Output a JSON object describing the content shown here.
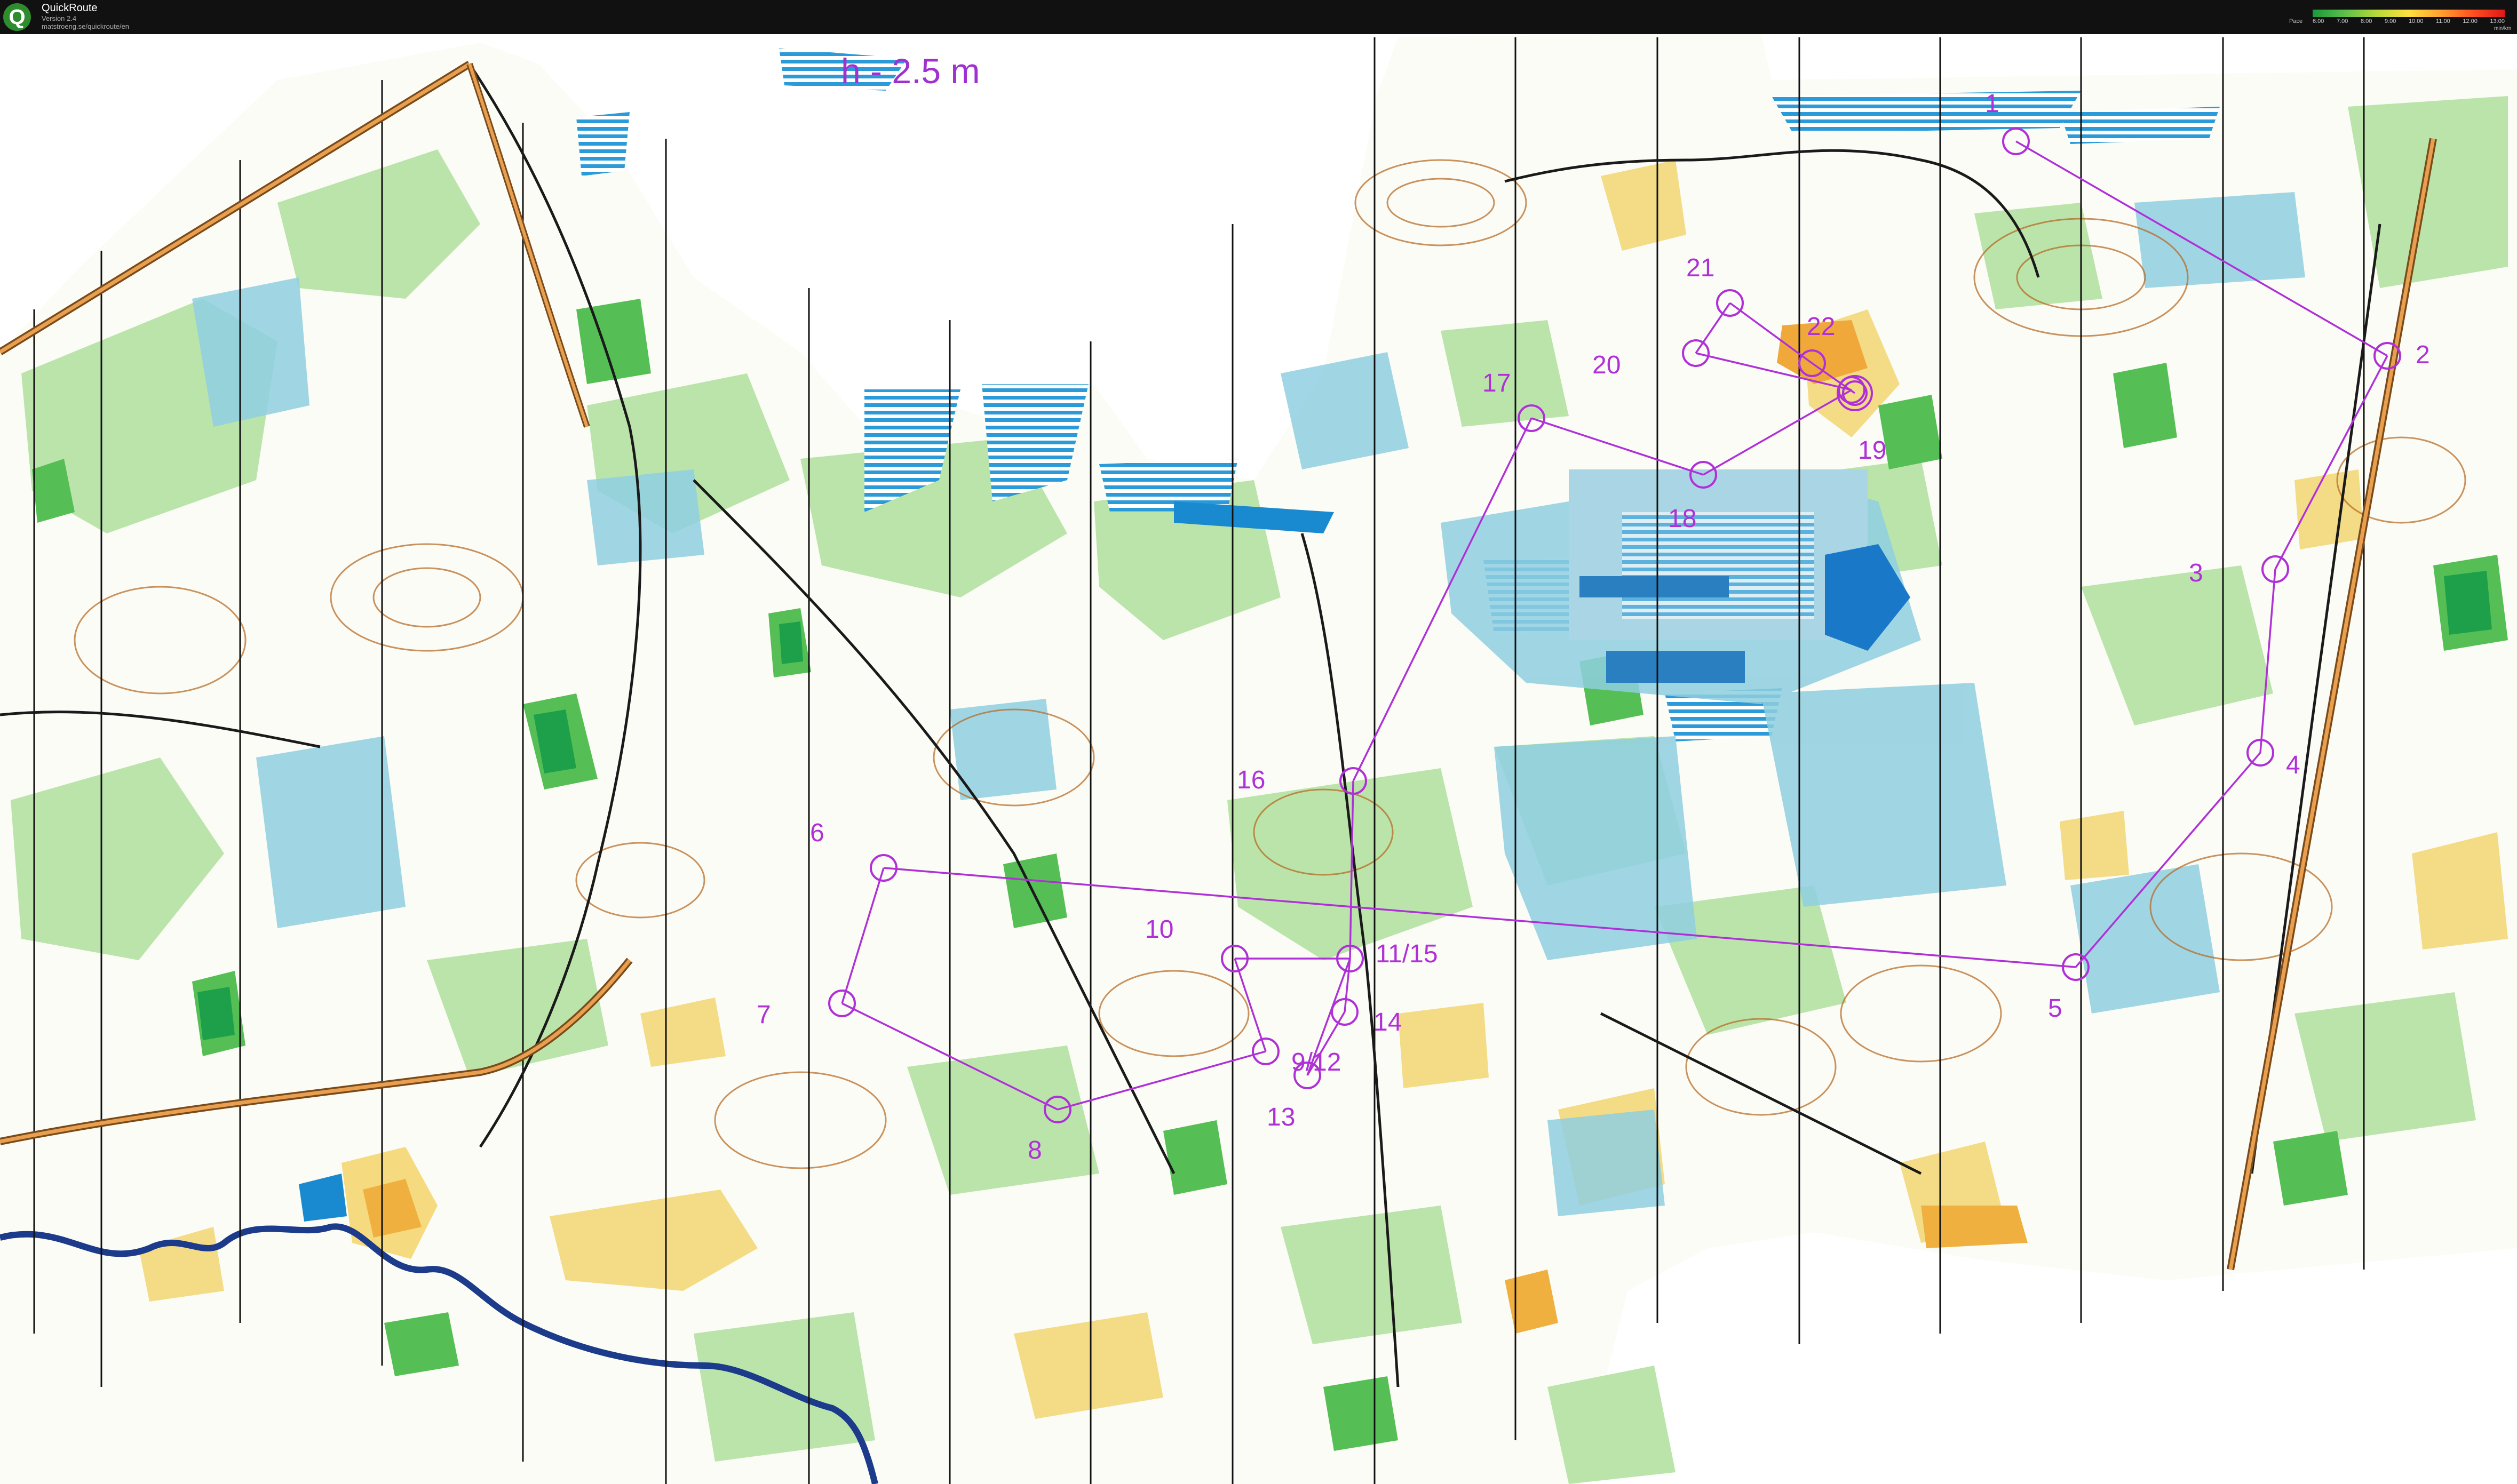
{
  "app": {
    "title": "QuickRoute",
    "version": "Version 2.4",
    "url": "matstroeng.se/quickroute/en"
  },
  "pace_legend": {
    "label": "Pace",
    "ticks": [
      "6:00",
      "7:00",
      "8:00",
      "9:00",
      "10:00",
      "11:00",
      "12:00",
      "13:00"
    ],
    "unit": "min/km"
  },
  "map": {
    "equidistance": "h - 2.5 m",
    "course_color": "#b030d8",
    "control_labels": [
      "1",
      "2",
      "3",
      "4",
      "5",
      "6",
      "7",
      "8",
      "9/12",
      "10",
      "11/15",
      "13",
      "14",
      "16",
      "17",
      "18",
      "19",
      "20",
      "21",
      "22"
    ]
  }
}
